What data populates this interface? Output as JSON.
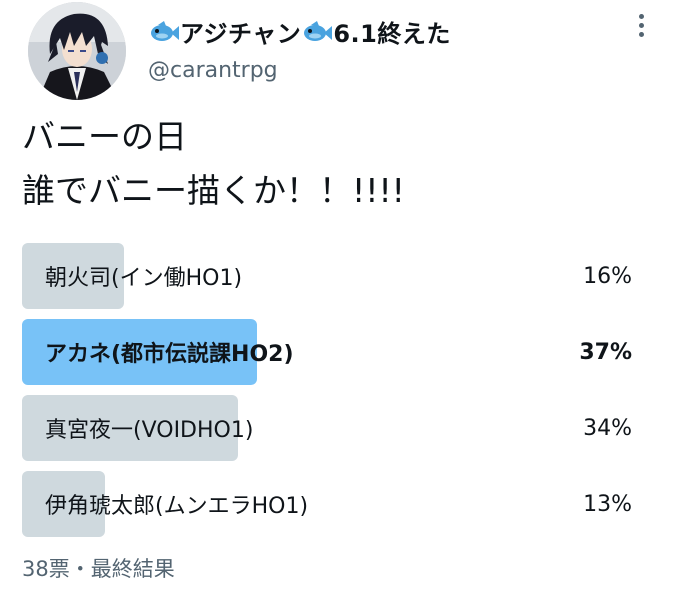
{
  "tweet": {
    "author": {
      "display_name": "アジチャン",
      "display_name_suffix": "6.1終えた",
      "handle": "@carantrpg",
      "avatar_icon": "avatar-anime-character",
      "name_emoji_icon": "fish-icon"
    },
    "more_icon": "more-vertical-icon",
    "text": "バニーの日\n誰でバニー描くか！！!!!!"
  },
  "poll": {
    "options": [
      {
        "label": "朝火司(イン働HO1)",
        "percent_text": "16%",
        "percent": 16,
        "winner": false
      },
      {
        "label": "アカネ(都市伝説課HO2)",
        "percent_text": "37%",
        "percent": 37,
        "winner": true
      },
      {
        "label": "真宮夜一(VOIDHO1)",
        "percent_text": "34%",
        "percent": 34,
        "winner": false
      },
      {
        "label": "伊角琥太郎(ムンエラHO1)",
        "percent_text": "13%",
        "percent": 13,
        "winner": false
      }
    ],
    "footer": "38票・最終結果"
  },
  "colors": {
    "bar_default": "#cfd9de",
    "bar_winner": "#78c2f7",
    "secondary_text": "#536471",
    "primary_text": "#0f1419"
  }
}
